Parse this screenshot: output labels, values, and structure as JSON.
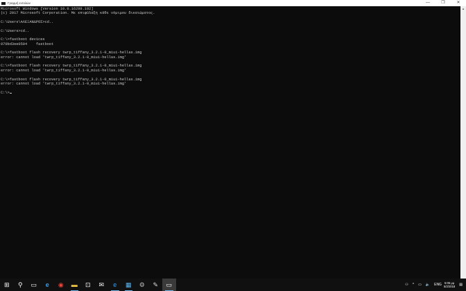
{
  "window": {
    "title": "Γραμμή εντολών",
    "controls": {
      "minimize": "—",
      "maximize": "❐",
      "close": "✕"
    }
  },
  "console": {
    "lines": [
      "Microsoft Windows [Version 10.0.16299.192]",
      "(c) 2017 Microsoft Corporation. Με επιφύλαξη κάθε νόμιμου δικαιώματος.",
      "",
      "C:\\Users\\ΑΛΕΞΑΝΔΡΟΣ>cd..",
      "",
      "C:\\Users>cd..",
      "",
      "C:\\>fastboot devices",
      "070bd3ee0504    fastboot",
      "",
      "C:\\>fastboot flash recovery twrp_tiffany_3.2.1-0_miui-hellas.img",
      "error: cannot load 'twrp_tiffany_3.2.1-0_miui-hellas.img'",
      "",
      "C:\\>fastboot flash recovery twrp_tiffany_3.2.1-0_miui-hellas.img",
      "error: cannot load 'twrp_tiffany_3.2.1-0_miui-hellas.img'",
      "",
      "C:\\>fastboot flash recovery twrp_tiffany_3.2.1-0_miui-hellas.img",
      "error: cannot load 'twrp_tiffany_3.2.1-0_miui-hellas.img'",
      ""
    ],
    "prompt": "C:\\>"
  },
  "taskbar": {
    "icons": [
      "⊞",
      "⚲",
      "▭",
      "e",
      "◉",
      "▬",
      "⊡",
      "✉",
      "e",
      "▦",
      "⚙",
      "✎",
      "▭"
    ],
    "tray": {
      "people": "⚇",
      "chevron": "^",
      "network": "▭",
      "volume": "🔈",
      "language": "ENG",
      "time": "5:05 μμ",
      "date": "5/2/2018",
      "notifications": "▤"
    }
  }
}
